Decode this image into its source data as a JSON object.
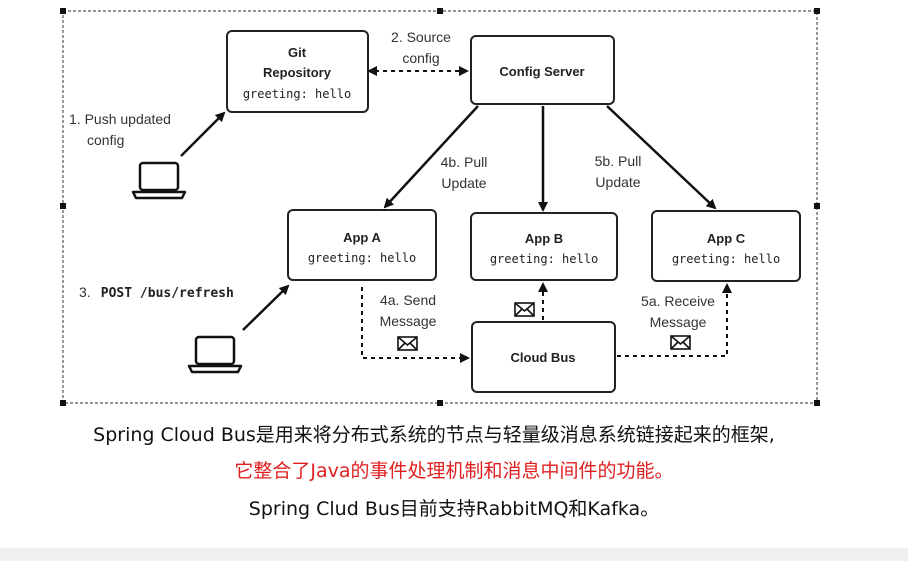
{
  "diagram": {
    "git_repo": {
      "title_line1": "Git",
      "title_line2": "Repository",
      "content": "greeting: hello"
    },
    "config_server": {
      "title": "Config Server"
    },
    "app_a": {
      "title": "App A",
      "content": "greeting: hello"
    },
    "app_b": {
      "title": "App B",
      "content": "greeting: hello"
    },
    "app_c": {
      "title": "App C",
      "content": "greeting: hello"
    },
    "cloud_bus": {
      "title": "Cloud Bus"
    },
    "labels": {
      "step1_line1": "1. Push updated",
      "step1_line2": "config",
      "step2_line1": "2. Source",
      "step2_line2": "config",
      "step3_prefix": "3.",
      "step3_cmd": "POST /bus/refresh",
      "step4a_line1": "4a. Send",
      "step4a_line2": "Message",
      "step4b_line1": "4b. Pull",
      "step4b_line2": "Update",
      "step5a_line1": "5a. Receive",
      "step5a_line2": "Message",
      "step5b_line1": "5b. Pull",
      "step5b_line2": "Update"
    }
  },
  "captions": {
    "line1": "Spring Cloud Bus是用来将分布式系统的节点与轻量级消息系统链接起来的框架,",
    "line2": "它整合了Java的事件处理机制和消息中间件的功能。",
    "line3": "Spring Clud Bus目前支持RabbitMQ和Kafka。"
  },
  "colors": {
    "highlight": "#e02020",
    "text": "#111111",
    "border": "#222222"
  },
  "icons": [
    "laptop-icon",
    "envelope-icon"
  ]
}
